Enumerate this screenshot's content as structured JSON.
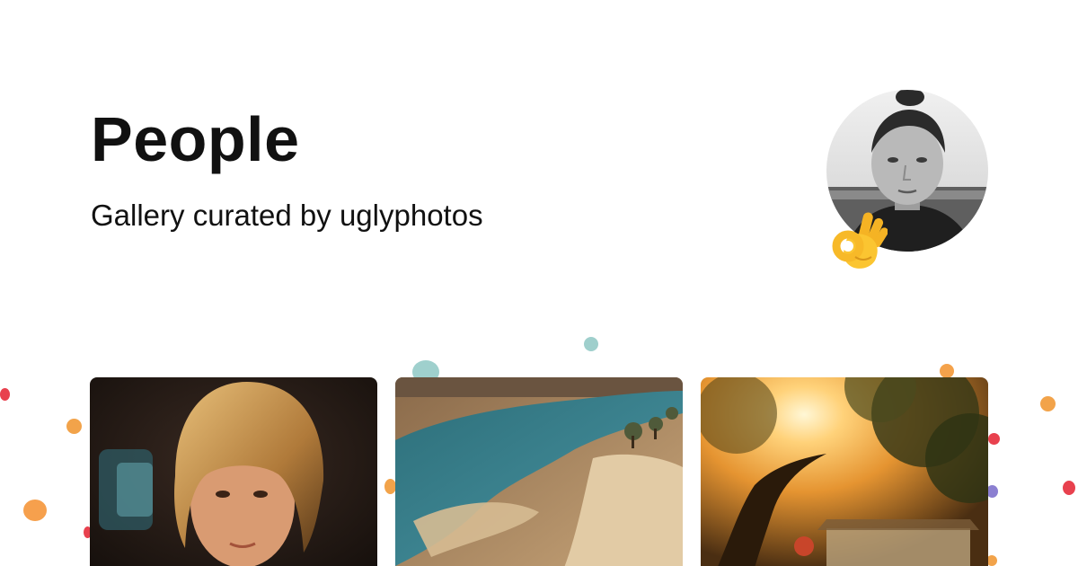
{
  "header": {
    "title": "People",
    "subtitle": "Gallery curated by uglyphotos"
  },
  "curator": {
    "avatar_icon": "curator-avatar",
    "badge_icon": "ok-hand-emoji-icon"
  },
  "gallery": {
    "photos": [
      {
        "subject": "child-with-bangs-photo"
      },
      {
        "subject": "river-landscape-photo"
      },
      {
        "subject": "sunset-tree-photo"
      }
    ]
  },
  "colors": {
    "background": "#ffffff",
    "text": "#111111",
    "confetti": [
      "#f2a34a",
      "#e8414e",
      "#7fc0bf",
      "#8b7fd1"
    ]
  }
}
